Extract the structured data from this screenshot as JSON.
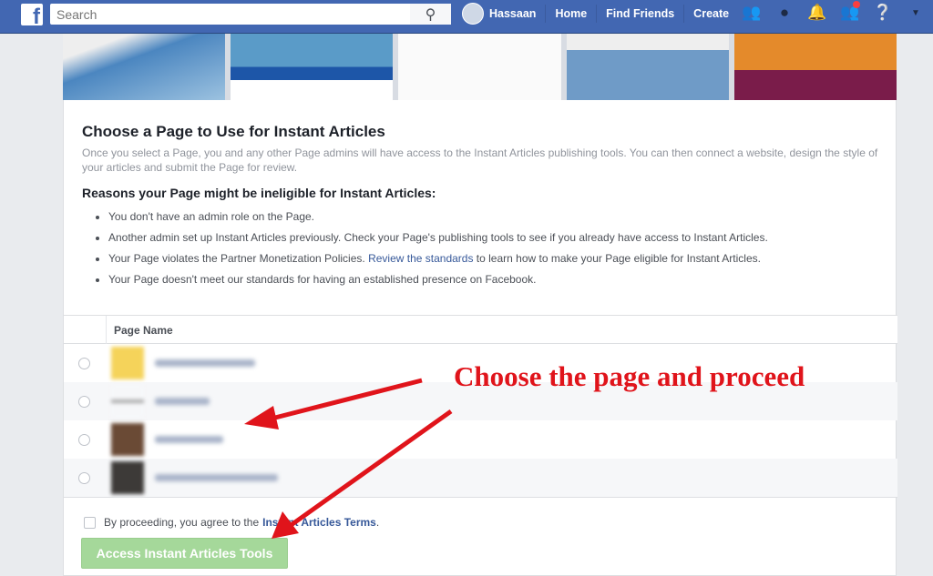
{
  "topbar": {
    "search_placeholder": "Search",
    "user_name": "Hassaan",
    "nav": [
      "Home",
      "Find Friends",
      "Create"
    ],
    "icons": [
      "friends-icon",
      "messenger-icon",
      "notifications-icon",
      "quick-help-icon",
      "help-icon",
      "dropdown-icon"
    ]
  },
  "main": {
    "title": "Choose a Page to Use for Instant Articles",
    "description": "Once you select a Page, you and any other Page admins will have access to the Instant Articles publishing tools. You can then connect a website, design the style of your articles and submit the Page for review.",
    "reasons_title": "Reasons your Page might be ineligible for Instant Articles:",
    "reasons": [
      "You don't have an admin role on the Page.",
      "Another admin set up Instant Articles previously. Check your Page's publishing tools to see if you already have access to Instant Articles."
    ],
    "reason3_pre": "Your Page violates the Partner Monetization Policies. ",
    "reason3_link": "Review the standards",
    "reason3_post": " to learn how to make your Page eligible for Instant Articles.",
    "reason4": "Your Page doesn't meet our standards for having an established presence on Facebook.",
    "table_header": "Page Name",
    "agree_text": "By proceeding, you agree to the",
    "agree_link": "Instant Articles Terms",
    "agree_end": ".",
    "button": "Access Instant Articles Tools"
  },
  "annotation": "Choose the page and proceed",
  "colors": {
    "brand": "#4267b2",
    "annotation": "#e0141b",
    "button": "#a5d89a"
  }
}
